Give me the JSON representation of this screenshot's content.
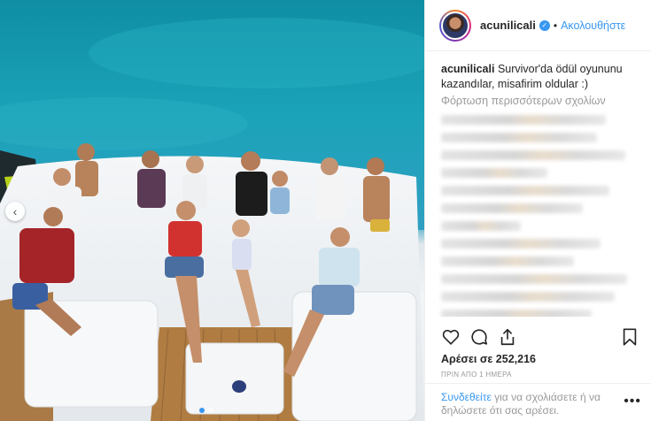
{
  "post": {
    "username": "acunilicali",
    "verified": true,
    "follow_label": "Ακολουθήστε",
    "caption_user": "acunilicali",
    "caption_text": "Survivor'da ödül oyununu kazandılar, misafirim oldular :)",
    "load_more_comments": "Φόρτωση περισσότερων σχολίων",
    "likes_label": "Αρέσει σε 252,216",
    "timestamp": "ΠΡΙΝ ΑΠΟ 1 ΗΜΕΡΑ",
    "login_link": "Συνδεθείτε",
    "login_text": " για να σχολιάσετε ή να δηλώσετε ότι σας αρέσει."
  },
  "icons": {
    "like": "heart-icon",
    "comment": "comment-icon",
    "share": "share-icon",
    "save": "bookmark-icon",
    "more": "more-options-icon",
    "prev": "chevron-left-icon"
  },
  "colors": {
    "link": "#3897f0",
    "muted": "#999999",
    "sea": "#1a97ad"
  },
  "carousel": {
    "total": 2,
    "active": 1
  }
}
